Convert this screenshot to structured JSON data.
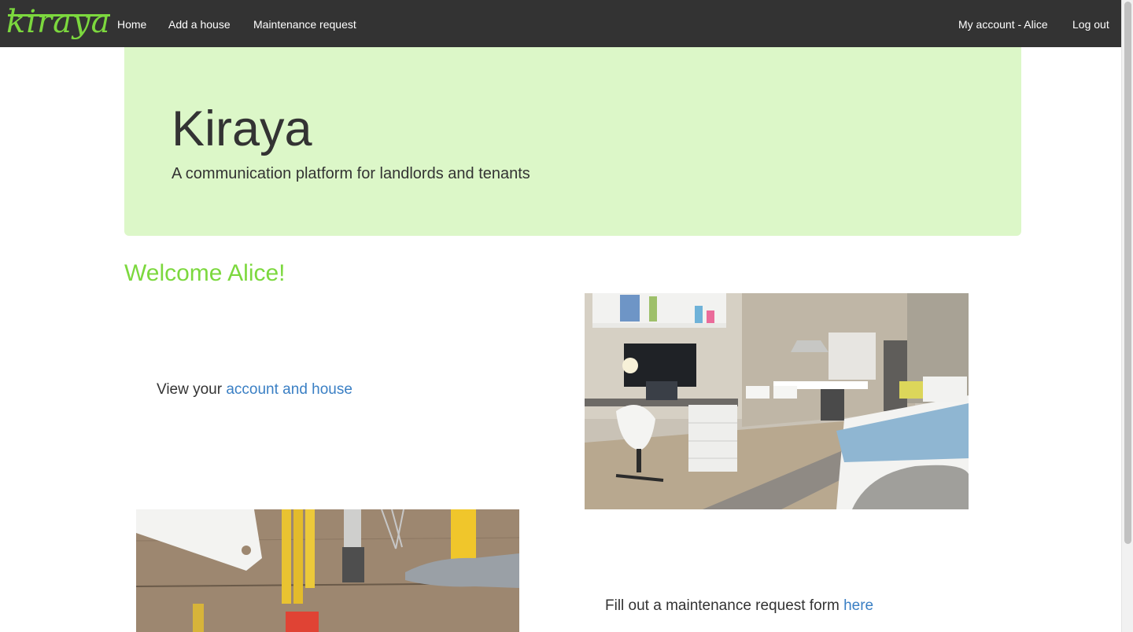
{
  "nav": {
    "logo": "kiraya",
    "home": "Home",
    "add_house": "Add a house",
    "maintenance": "Maintenance request",
    "account": "My account - Alice",
    "logout": "Log out"
  },
  "jumbotron": {
    "title": "Kiraya",
    "subtitle": "A communication platform for landlords and tenants"
  },
  "welcome": "Welcome Alice!",
  "account_section": {
    "prefix": "View your ",
    "link": "account and house"
  },
  "maintenance_section": {
    "prefix": "Fill out a maintenance request form ",
    "link": "here"
  },
  "colors": {
    "navbar": "#333333",
    "brand_green": "#7cd83e",
    "jumbotron_bg": "#dcf7c8",
    "link_blue": "#3a7fc4"
  },
  "icons": {
    "logo": "kiraya-logo"
  }
}
